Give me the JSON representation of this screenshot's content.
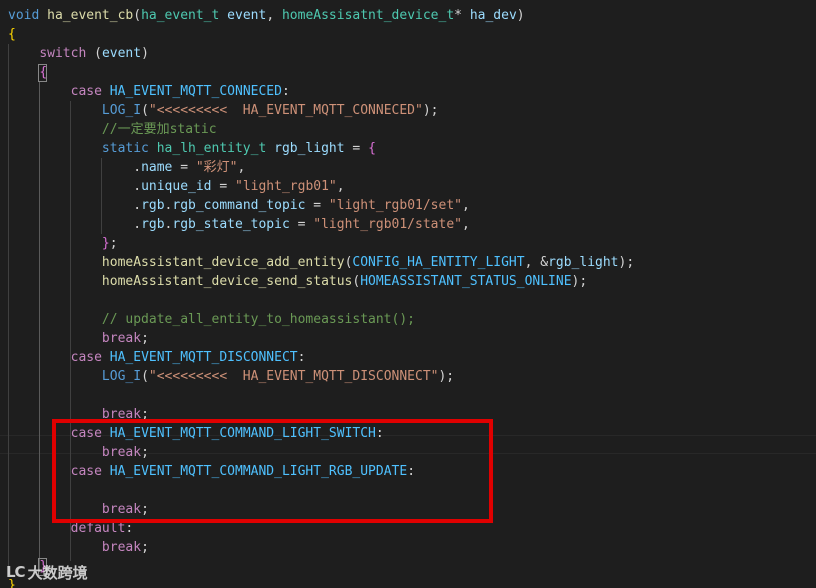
{
  "editor": {
    "language": "c",
    "lines": [
      [
        [
          "k-keyword",
          "void"
        ],
        [
          "k-punct",
          " "
        ],
        [
          "k-func",
          "ha_event_cb"
        ],
        [
          "k-punct",
          "("
        ],
        [
          "k-type",
          "ha_event_t"
        ],
        [
          "k-punct",
          " "
        ],
        [
          "k-param",
          "event"
        ],
        [
          "k-punct",
          ", "
        ],
        [
          "k-type",
          "homeAssisatnt_device_t"
        ],
        [
          "k-punct",
          "* "
        ],
        [
          "k-param",
          "ha_dev"
        ],
        [
          "k-punct",
          ")"
        ]
      ],
      [
        [
          "k-brace",
          "{"
        ]
      ],
      [
        [
          "k-punct",
          "    "
        ],
        [
          "k-control",
          "switch"
        ],
        [
          "k-punct",
          " ("
        ],
        [
          "k-param",
          "event"
        ],
        [
          "k-punct",
          ")"
        ]
      ],
      [
        [
          "k-punct",
          "    "
        ],
        [
          "k-brace2",
          "{"
        ]
      ],
      [
        [
          "k-punct",
          "        "
        ],
        [
          "k-control",
          "case"
        ],
        [
          "k-punct",
          " "
        ],
        [
          "k-macro",
          "HA_EVENT_MQTT_CONNECED"
        ],
        [
          "k-punct",
          ":"
        ]
      ],
      [
        [
          "k-punct",
          "            "
        ],
        [
          "k-keyword",
          "LOG_I"
        ],
        [
          "k-punct",
          "("
        ],
        [
          "k-string",
          "\"<<<<<<<<<  HA_EVENT_MQTT_CONNECED\""
        ],
        [
          "k-punct",
          ");"
        ]
      ],
      [
        [
          "k-punct",
          "            "
        ],
        [
          "k-comment",
          "//一定要加static"
        ]
      ],
      [
        [
          "k-punct",
          "            "
        ],
        [
          "k-keyword",
          "static"
        ],
        [
          "k-punct",
          " "
        ],
        [
          "k-type",
          "ha_lh_entity_t"
        ],
        [
          "k-punct",
          " "
        ],
        [
          "k-param",
          "rgb_light"
        ],
        [
          "k-punct",
          " = "
        ],
        [
          "k-brace2",
          "{"
        ]
      ],
      [
        [
          "k-punct",
          "                ."
        ],
        [
          "k-param",
          "name"
        ],
        [
          "k-punct",
          " = "
        ],
        [
          "k-string",
          "\"彩灯\""
        ],
        [
          "k-punct",
          ","
        ]
      ],
      [
        [
          "k-punct",
          "                ."
        ],
        [
          "k-param",
          "unique_id"
        ],
        [
          "k-punct",
          " = "
        ],
        [
          "k-string",
          "\"light_rgb01\""
        ],
        [
          "k-punct",
          ","
        ]
      ],
      [
        [
          "k-punct",
          "                ."
        ],
        [
          "k-param",
          "rgb"
        ],
        [
          "k-punct",
          "."
        ],
        [
          "k-param",
          "rgb_command_topic"
        ],
        [
          "k-punct",
          " = "
        ],
        [
          "k-string",
          "\"light_rgb01/set\""
        ],
        [
          "k-punct",
          ","
        ]
      ],
      [
        [
          "k-punct",
          "                ."
        ],
        [
          "k-param",
          "rgb"
        ],
        [
          "k-punct",
          "."
        ],
        [
          "k-param",
          "rgb_state_topic"
        ],
        [
          "k-punct",
          " = "
        ],
        [
          "k-string",
          "\"light_rgb01/state\""
        ],
        [
          "k-punct",
          ","
        ]
      ],
      [
        [
          "k-punct",
          "            "
        ],
        [
          "k-brace2",
          "}"
        ],
        [
          "k-punct",
          ";"
        ]
      ],
      [
        [
          "k-punct",
          "            "
        ],
        [
          "k-func",
          "homeAssistant_device_add_entity"
        ],
        [
          "k-punct",
          "("
        ],
        [
          "k-macro",
          "CONFIG_HA_ENTITY_LIGHT"
        ],
        [
          "k-punct",
          ", &"
        ],
        [
          "k-param",
          "rgb_light"
        ],
        [
          "k-punct",
          ");"
        ]
      ],
      [
        [
          "k-punct",
          "            "
        ],
        [
          "k-func",
          "homeAssistant_device_send_status"
        ],
        [
          "k-punct",
          "("
        ],
        [
          "k-macro",
          "HOMEASSISTANT_STATUS_ONLINE"
        ],
        [
          "k-punct",
          ");"
        ]
      ],
      [],
      [
        [
          "k-punct",
          "            "
        ],
        [
          "k-comment",
          "// update_all_entity_to_homeassistant();"
        ]
      ],
      [
        [
          "k-punct",
          "            "
        ],
        [
          "k-control",
          "break"
        ],
        [
          "k-punct",
          ";"
        ]
      ],
      [
        [
          "k-punct",
          "        "
        ],
        [
          "k-control",
          "case"
        ],
        [
          "k-punct",
          " "
        ],
        [
          "k-macro",
          "HA_EVENT_MQTT_DISCONNECT"
        ],
        [
          "k-punct",
          ":"
        ]
      ],
      [
        [
          "k-punct",
          "            "
        ],
        [
          "k-keyword",
          "LOG_I"
        ],
        [
          "k-punct",
          "("
        ],
        [
          "k-string",
          "\"<<<<<<<<<  HA_EVENT_MQTT_DISCONNECT\""
        ],
        [
          "k-punct",
          ");"
        ]
      ],
      [],
      [
        [
          "k-punct",
          "            "
        ],
        [
          "k-control",
          "break"
        ],
        [
          "k-punct",
          ";"
        ]
      ],
      [
        [
          "k-punct",
          "        "
        ],
        [
          "k-control",
          "case"
        ],
        [
          "k-punct",
          " "
        ],
        [
          "k-macro",
          "HA_EVENT_MQTT_COMMAND_LIGHT_SWITCH"
        ],
        [
          "k-punct",
          ":"
        ]
      ],
      [
        [
          "k-punct",
          "            "
        ],
        [
          "k-control",
          "break"
        ],
        [
          "k-punct",
          ";"
        ]
      ],
      [
        [
          "k-punct",
          "        "
        ],
        [
          "k-control",
          "case"
        ],
        [
          "k-punct",
          " "
        ],
        [
          "k-macro",
          "HA_EVENT_MQTT_COMMAND_LIGHT_RGB_UPDATE"
        ],
        [
          "k-punct",
          ":"
        ]
      ],
      [],
      [
        [
          "k-punct",
          "            "
        ],
        [
          "k-control",
          "break"
        ],
        [
          "k-punct",
          ";"
        ]
      ],
      [
        [
          "k-punct",
          "        "
        ],
        [
          "k-control",
          "default"
        ],
        [
          "k-punct",
          ":"
        ]
      ],
      [
        [
          "k-punct",
          "            "
        ],
        [
          "k-control",
          "break"
        ],
        [
          "k-punct",
          ";"
        ]
      ],
      [
        [
          "k-punct",
          "    "
        ],
        [
          "k-brace2",
          "}"
        ]
      ],
      [
        [
          "k-brace",
          "}"
        ]
      ]
    ]
  },
  "annotation": {
    "highlight_color": "#e00000",
    "highlighted_lines": [
      22,
      23,
      24,
      25,
      26
    ]
  },
  "watermark": {
    "logo": "LC",
    "text": "大数跨境"
  }
}
